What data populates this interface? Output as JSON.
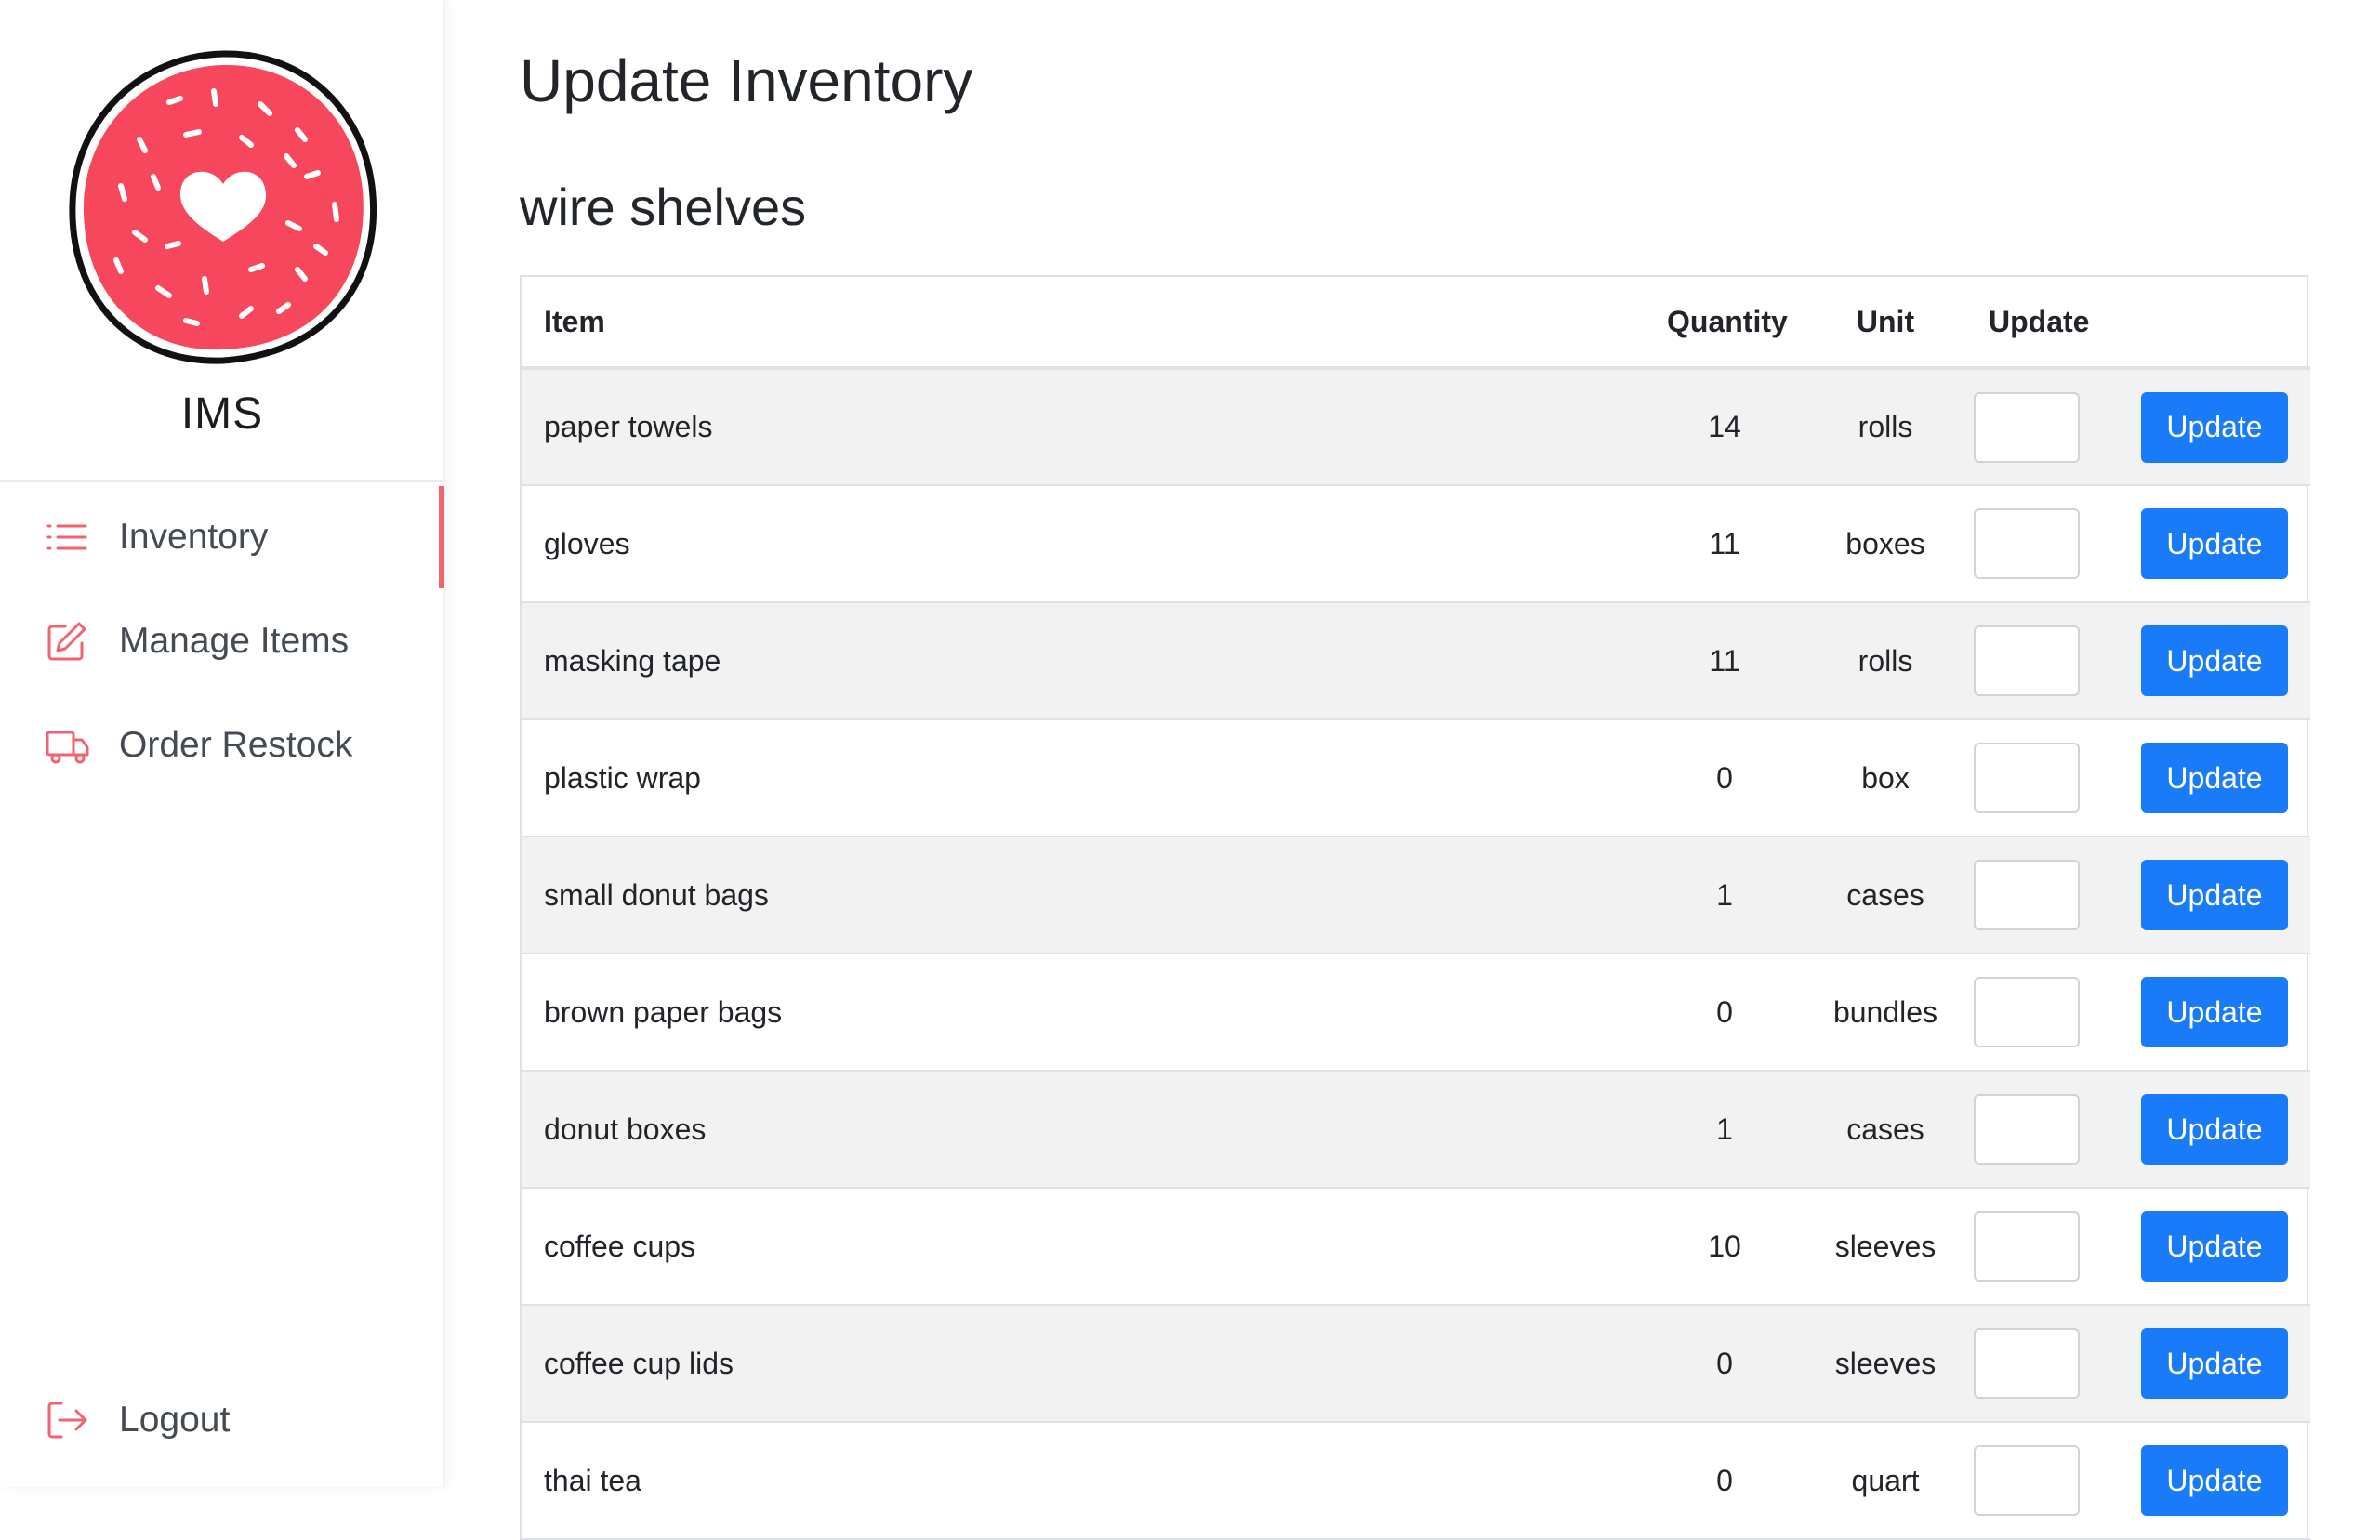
{
  "brand": {
    "name": "IMS"
  },
  "nav": {
    "inventory": "Inventory",
    "manage": "Manage Items",
    "restock": "Order Restock",
    "logout": "Logout"
  },
  "page": {
    "title": "Update Inventory",
    "section": "wire shelves"
  },
  "table": {
    "headers": {
      "item": "Item",
      "quantity": "Quantity",
      "unit": "Unit",
      "update": "Update"
    },
    "button_label": "Update",
    "rows": [
      {
        "item": "paper towels",
        "quantity": "14",
        "unit": "rolls"
      },
      {
        "item": "gloves",
        "quantity": "11",
        "unit": "boxes"
      },
      {
        "item": "masking tape",
        "quantity": "11",
        "unit": "rolls"
      },
      {
        "item": "plastic wrap",
        "quantity": "0",
        "unit": "box"
      },
      {
        "item": "small donut bags",
        "quantity": "1",
        "unit": "cases"
      },
      {
        "item": "brown paper bags",
        "quantity": "0",
        "unit": "bundles"
      },
      {
        "item": "donut boxes",
        "quantity": "1",
        "unit": "cases"
      },
      {
        "item": "coffee cups",
        "quantity": "10",
        "unit": "sleeves"
      },
      {
        "item": "coffee cup lids",
        "quantity": "0",
        "unit": "sleeves"
      },
      {
        "item": "thai tea",
        "quantity": "0",
        "unit": "quart"
      }
    ]
  },
  "colors": {
    "accent": "#f2626f",
    "donut": "#f7475d",
    "button": "#1a7bf9",
    "stripe": "#f2f2f2"
  },
  "icons": {
    "inventory": "list-icon",
    "manage": "edit-icon",
    "restock": "truck-icon",
    "logout": "logout-icon",
    "logo": "donut-logo"
  }
}
